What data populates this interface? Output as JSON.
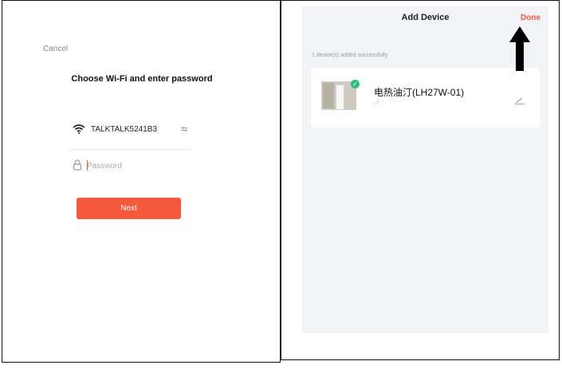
{
  "left_screen": {
    "cancel_label": "Cancel",
    "title": "Choose Wi-Fi and enter password",
    "wifi_name": "TALKTALK5241B3",
    "password_placeholder": "Password",
    "password_value": "",
    "next_label": "Next"
  },
  "right_screen": {
    "title": "Add Device",
    "done_label": "Done",
    "added_message": "1 device(s) added successfully",
    "device": {
      "name": "电热油汀(LH27W-01)",
      "subtitle": ",                          /"
    }
  },
  "colors": {
    "accent": "#f5593b",
    "success": "#2fbf7a",
    "arrow": "#000000"
  },
  "icons": [
    "wifi-icon",
    "swap-icon",
    "lock-icon",
    "check-icon",
    "edit-icon",
    "arrow-up-icon"
  ]
}
